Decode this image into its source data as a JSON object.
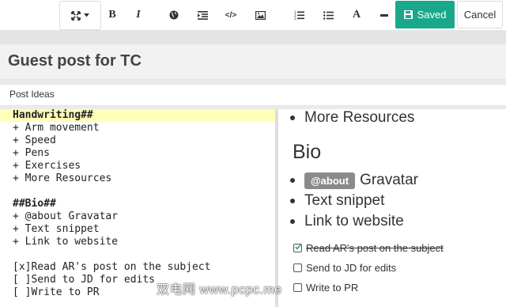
{
  "toolbar": {
    "saved_label": "Saved",
    "cancel_label": "Cancel",
    "bold_glyph": "B",
    "italic_glyph": "I",
    "heading_glyph": "A",
    "code_glyph": "</>",
    "icons": [
      "expand-icon",
      "bold-icon",
      "italic-icon",
      "globe-icon",
      "indent-icon",
      "code-icon",
      "image-icon",
      "numbered-list-icon",
      "bulleted-list-icon",
      "heading-icon",
      "horizontal-rule-icon",
      "save-icon"
    ]
  },
  "title": "Guest post for TC",
  "tags": "Post Ideas",
  "editor_lines": [
    "Handwriting##",
    "+ Arm movement",
    "+ Speed",
    "+ Pens",
    "+ Exercises",
    "+ More Resources",
    "",
    "##Bio##",
    "+ @about Gravatar",
    "+ Text snippet",
    "+ Link to website",
    "",
    "[x]Read AR's post on the subject",
    "[ ]Send to JD for edits",
    "[ ]Write to PR"
  ],
  "preview": {
    "top_item": "More Resources",
    "heading": "Bio",
    "badge": "@about",
    "badge_rest": "Gravatar",
    "items": [
      "Text snippet",
      "Link to website"
    ],
    "tasks": [
      {
        "text": "Read AR's post on the subject",
        "done": true
      },
      {
        "text": "Send to JD for edits",
        "done": false
      },
      {
        "text": "Write to PR",
        "done": false
      }
    ]
  },
  "watermark": "双电网 www.pcpc.me",
  "colors": {
    "accent": "#1aa88a",
    "highlight": "#ffffb8",
    "badge": "#8a8a8a"
  }
}
